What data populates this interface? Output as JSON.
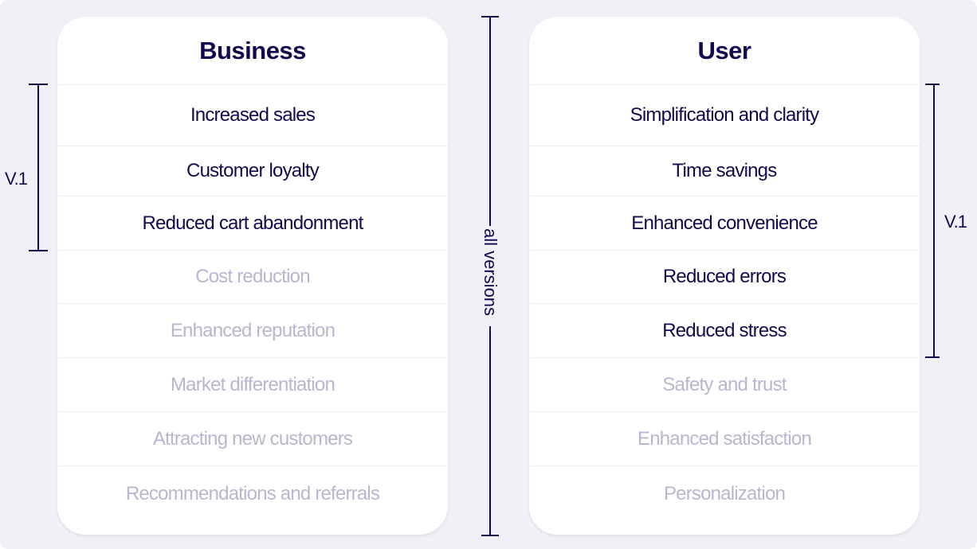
{
  "colors": {
    "background": "#f1f0f6",
    "card": "#ffffff",
    "active_text": "#120a4f",
    "inactive_text": "#b9b6cf",
    "divider": "#ececf1",
    "bracket": "#120a4f"
  },
  "business": {
    "title": "Business",
    "items": [
      {
        "label": "Increased sales",
        "in_v1": true
      },
      {
        "label": "Customer loyalty",
        "in_v1": true
      },
      {
        "label": "Reduced cart abandonment",
        "in_v1": true
      },
      {
        "label": "Cost reduction",
        "in_v1": false
      },
      {
        "label": "Enhanced reputation",
        "in_v1": false
      },
      {
        "label": "Market differentiation",
        "in_v1": false
      },
      {
        "label": "Attracting new customers",
        "in_v1": false
      },
      {
        "label": "Recommendations and referrals",
        "in_v1": false
      }
    ],
    "bracket_label": "V.1"
  },
  "user": {
    "title": "User",
    "items": [
      {
        "label": "Simplification and clarity",
        "in_v1": true
      },
      {
        "label": "Time savings",
        "in_v1": true
      },
      {
        "label": "Enhanced convenience",
        "in_v1": true
      },
      {
        "label": "Reduced errors",
        "in_v1": true
      },
      {
        "label": "Reduced stress",
        "in_v1": true
      },
      {
        "label": "Safety and trust",
        "in_v1": false
      },
      {
        "label": "Enhanced satisfaction",
        "in_v1": false
      },
      {
        "label": "Personalization",
        "in_v1": false
      }
    ],
    "bracket_label": "V.1"
  },
  "all_versions_label": "all versions"
}
